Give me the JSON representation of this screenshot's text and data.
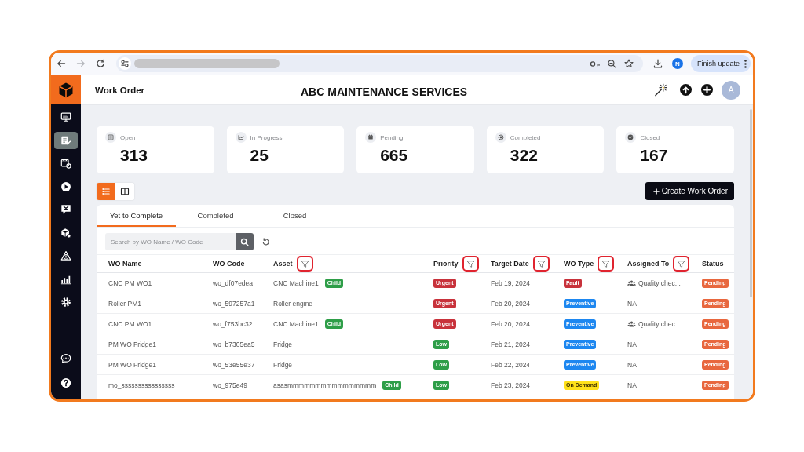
{
  "browser": {
    "forward_disabled": true,
    "profile_initial": "N",
    "update_button": "Finish update"
  },
  "sidebar": {
    "items": [
      {
        "selected": false
      },
      {
        "selected": true
      },
      {
        "selected": false
      },
      {
        "selected": false
      },
      {
        "selected": false
      },
      {
        "selected": false
      },
      {
        "selected": false
      },
      {
        "selected": false
      },
      {
        "selected": false
      }
    ],
    "bottom_items": [
      {
        "selected": false
      },
      {
        "selected": false
      }
    ]
  },
  "header": {
    "title": "Work Order",
    "company": "ABC MAINTENANCE SERVICES",
    "avatar_initial": "A"
  },
  "stats": [
    {
      "label": "Open",
      "value": "313"
    },
    {
      "label": "In Progress",
      "value": "25"
    },
    {
      "label": "Pending",
      "value": "665"
    },
    {
      "label": "Completed",
      "value": "322"
    },
    {
      "label": "Closed",
      "value": "167"
    }
  ],
  "view_toggle": [
    {
      "selected": true
    },
    {
      "selected": false
    }
  ],
  "create_button": "Create Work Order",
  "tabs": [
    {
      "label": "Yet to Complete",
      "selected": true
    },
    {
      "label": "Completed",
      "selected": false
    },
    {
      "label": "Closed",
      "selected": false
    }
  ],
  "search": {
    "placeholder": "Search by WO Name / WO Code"
  },
  "table": {
    "columns": [
      {
        "label": "WO Name",
        "filter": false
      },
      {
        "label": "WO Code",
        "filter": false
      },
      {
        "label": "Asset",
        "filter": true
      },
      {
        "label": "Priority",
        "filter": true
      },
      {
        "label": "Target Date",
        "filter": true
      },
      {
        "label": "WO Type",
        "filter": true
      },
      {
        "label": "Assigned To",
        "filter": true
      },
      {
        "label": "Status",
        "filter": false
      }
    ],
    "rows": [
      {
        "wo_name": "CNC PM WO1",
        "wo_code": "wo_df07edea",
        "asset": "CNC Machine1",
        "asset_tag": "Child",
        "priority": {
          "text": "Urgent",
          "color": "#c8323b"
        },
        "target_date": "Feb 19, 2024",
        "wo_type": {
          "text": "Fault",
          "color": "#c8323b"
        },
        "assigned_to": {
          "text": "Quality chec...",
          "kind": "team"
        },
        "status": {
          "text": "Pending",
          "color": "#e8673e"
        }
      },
      {
        "wo_name": "Roller PM1",
        "wo_code": "wo_597257a1",
        "asset": "Roller engine",
        "priority": {
          "text": "Urgent",
          "color": "#c8323b"
        },
        "target_date": "Feb 20, 2024",
        "wo_type": {
          "text": "Preventive",
          "color": "#1d87f0"
        },
        "assigned_to": {
          "text": "NA",
          "kind": "none"
        },
        "status": {
          "text": "Pending",
          "color": "#e8673e"
        }
      },
      {
        "wo_name": "CNC PM WO1",
        "wo_code": "wo_f753bc32",
        "asset": "CNC Machine1",
        "asset_tag": "Child",
        "priority": {
          "text": "Urgent",
          "color": "#c8323b"
        },
        "target_date": "Feb 20, 2024",
        "wo_type": {
          "text": "Preventive",
          "color": "#1d87f0"
        },
        "assigned_to": {
          "text": "Quality chec...",
          "kind": "team"
        },
        "status": {
          "text": "Pending",
          "color": "#e8673e"
        }
      },
      {
        "wo_name": "PM WO Fridge1",
        "wo_code": "wo_b7305ea5",
        "asset": "Fridge",
        "priority": {
          "text": "Low",
          "color": "#2e9e48"
        },
        "target_date": "Feb 21, 2024",
        "wo_type": {
          "text": "Preventive",
          "color": "#1d87f0"
        },
        "assigned_to": {
          "text": "NA",
          "kind": "none"
        },
        "status": {
          "text": "Pending",
          "color": "#e8673e"
        }
      },
      {
        "wo_name": "PM WO Fridge1",
        "wo_code": "wo_53e55e37",
        "asset": "Fridge",
        "priority": {
          "text": "Low",
          "color": "#2e9e48"
        },
        "target_date": "Feb 22, 2024",
        "wo_type": {
          "text": "Preventive",
          "color": "#1d87f0"
        },
        "assigned_to": {
          "text": "NA",
          "kind": "none"
        },
        "status": {
          "text": "Pending",
          "color": "#e8673e"
        }
      },
      {
        "wo_name": "mo_ssssssssssssssss",
        "wo_code": "wo_975e49",
        "asset": "asasmmmmmmmmmmmmmmmm",
        "asset_tag": "Child",
        "priority": {
          "text": "Low",
          "color": "#2e9e48"
        },
        "target_date": "Feb 23, 2024",
        "wo_type": {
          "text": "On Demand",
          "color": "#ffe11a"
        },
        "assigned_to": {
          "text": "NA",
          "kind": "none"
        },
        "status": {
          "text": "Pending",
          "color": "#e8673e"
        }
      }
    ]
  }
}
